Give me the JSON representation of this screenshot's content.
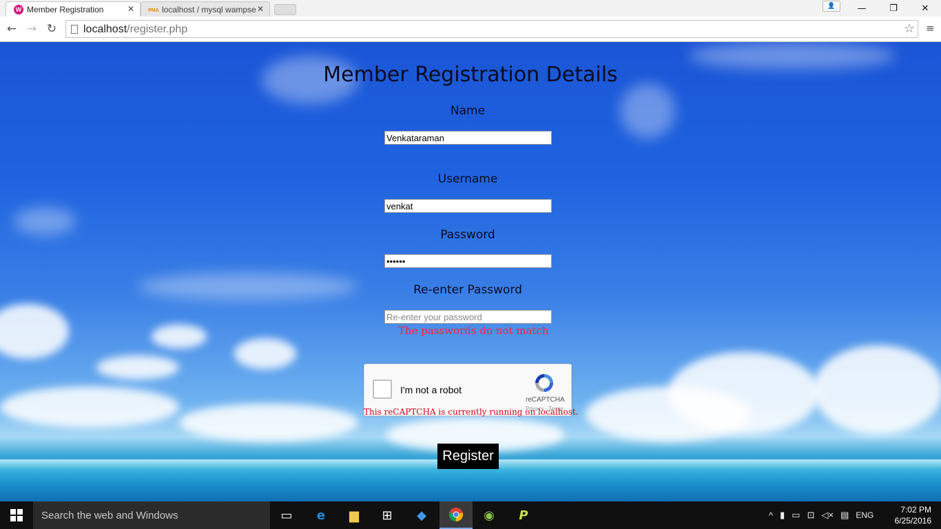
{
  "browser": {
    "tabs": [
      {
        "title": "Member Registration",
        "favicon": "W"
      },
      {
        "title": "localhost / mysql wampse",
        "favicon": "PMA"
      }
    ],
    "url_host": "localhost",
    "url_path": "/register.php"
  },
  "page": {
    "heading": "Member Registration Details",
    "fields": {
      "name": {
        "label": "Name",
        "value": "Venkataraman"
      },
      "username": {
        "label": "Username",
        "value": "venkat"
      },
      "password": {
        "label": "Password",
        "value": "••••••"
      },
      "repassword": {
        "label": "Re-enter Password",
        "placeholder": "Re-enter your password"
      }
    },
    "error": "The passwords do not match",
    "recaptcha": {
      "label": "I'm not a robot",
      "brand": "reCAPTCHA",
      "terms": "Privacy - Terms",
      "warning": "This reCAPTCHA is currently running on localhost."
    },
    "register_label": "Register"
  },
  "taskbar": {
    "search_placeholder": "Search the web and Windows",
    "language": "ENG",
    "time": "7:02 PM",
    "date": "6/25/2016"
  }
}
